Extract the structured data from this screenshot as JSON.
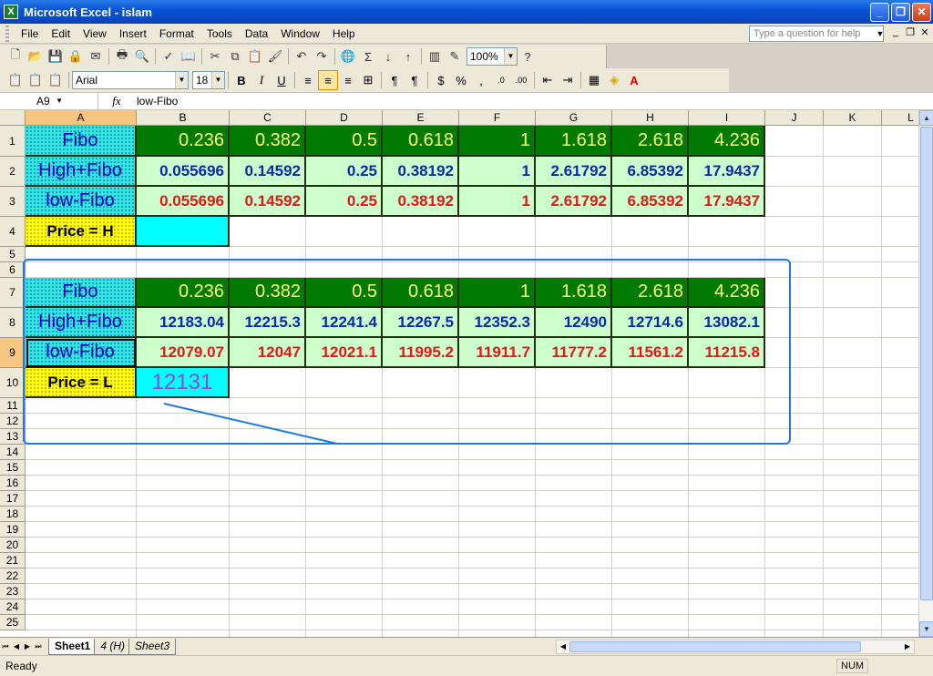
{
  "window": {
    "title": "Microsoft Excel - islam"
  },
  "menu": [
    "File",
    "Edit",
    "View",
    "Insert",
    "Format",
    "Tools",
    "Data",
    "Window",
    "Help"
  ],
  "help_placeholder": "Type a question for help",
  "toolbar": {
    "zoom": "100%",
    "font": "Arial",
    "font_size": "18"
  },
  "formula": {
    "cell_ref": "A9",
    "fx": "fx",
    "content": "low-Fibo"
  },
  "columns": [
    "A",
    "B",
    "C",
    "D",
    "E",
    "F",
    "G",
    "H",
    "I",
    "J",
    "K",
    "L"
  ],
  "rows": [
    "1",
    "2",
    "3",
    "4",
    "5",
    "6",
    "7",
    "8",
    "9",
    "10",
    "11",
    "12",
    "13",
    "14",
    "15",
    "16",
    "17",
    "18",
    "19",
    "20",
    "21",
    "22",
    "23",
    "24",
    "25"
  ],
  "table1": {
    "r1": [
      "Fibo",
      "0.236",
      "0.382",
      "0.5",
      "0.618",
      "1",
      "1.618",
      "2.618",
      "4.236"
    ],
    "r2": [
      "High+Fibo",
      "0.055696",
      "0.14592",
      "0.25",
      "0.38192",
      "1",
      "2.61792",
      "6.85392",
      "17.9437"
    ],
    "r3": [
      "low-Fibo",
      "0.055696",
      "0.14592",
      "0.25",
      "0.38192",
      "1",
      "2.61792",
      "6.85392",
      "17.9437"
    ],
    "r4": [
      "Price = H",
      ""
    ]
  },
  "table2": {
    "r7": [
      "Fibo",
      "0.236",
      "0.382",
      "0.5",
      "0.618",
      "1",
      "1.618",
      "2.618",
      "4.236"
    ],
    "r8": [
      "High+Fibo",
      "12183.04",
      "12215.3",
      "12241.4",
      "12267.5",
      "12352.3",
      "12490",
      "12714.6",
      "13082.1"
    ],
    "r9": [
      "low-Fibo",
      "12079.07",
      "12047",
      "12021.1",
      "11995.2",
      "11911.7",
      "11777.2",
      "11561.2",
      "11215.8"
    ],
    "r10": [
      "Price = L",
      "12131"
    ]
  },
  "sheets": [
    "Sheet1",
    "4 (H)",
    "Sheet3"
  ],
  "status": {
    "ready": "Ready",
    "num": "NUM"
  }
}
